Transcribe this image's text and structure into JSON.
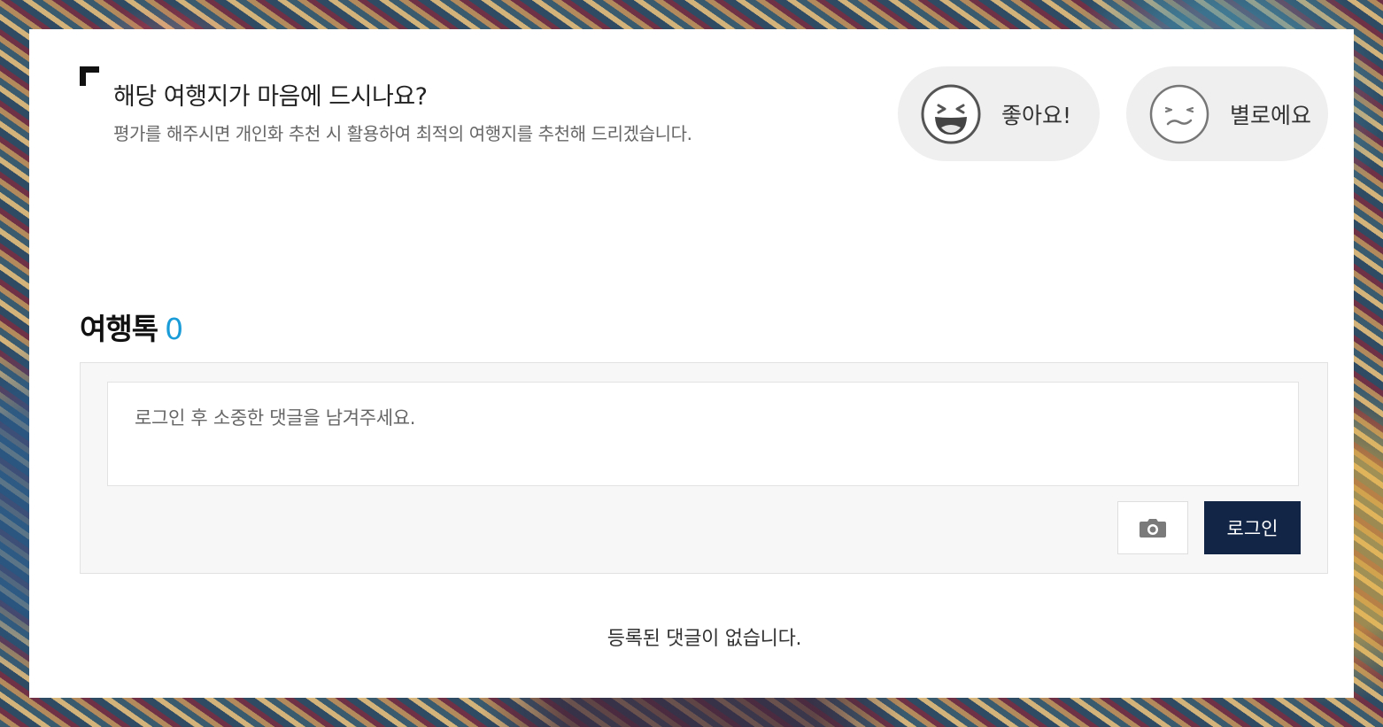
{
  "rating": {
    "title": "해당 여행지가 마음에 드시나요?",
    "description": "평가를 해주시면 개인화 추천 시 활용하여 최적의 여행지를 추천해 드리겠습니다.",
    "like_label": "좋아요!",
    "dislike_label": "별로에요",
    "like_icon": "laughing-face-icon",
    "dislike_icon": "frowning-face-icon"
  },
  "talk": {
    "title": "여행톡",
    "count": "0",
    "count_color": "#1a9cd8",
    "input_placeholder": "로그인 후 소중한 댓글을 남겨주세요.",
    "photo_icon": "camera-icon",
    "login_label": "로그인",
    "login_color": "#122546",
    "empty_message": "등록된 댓글이 없습니다."
  }
}
